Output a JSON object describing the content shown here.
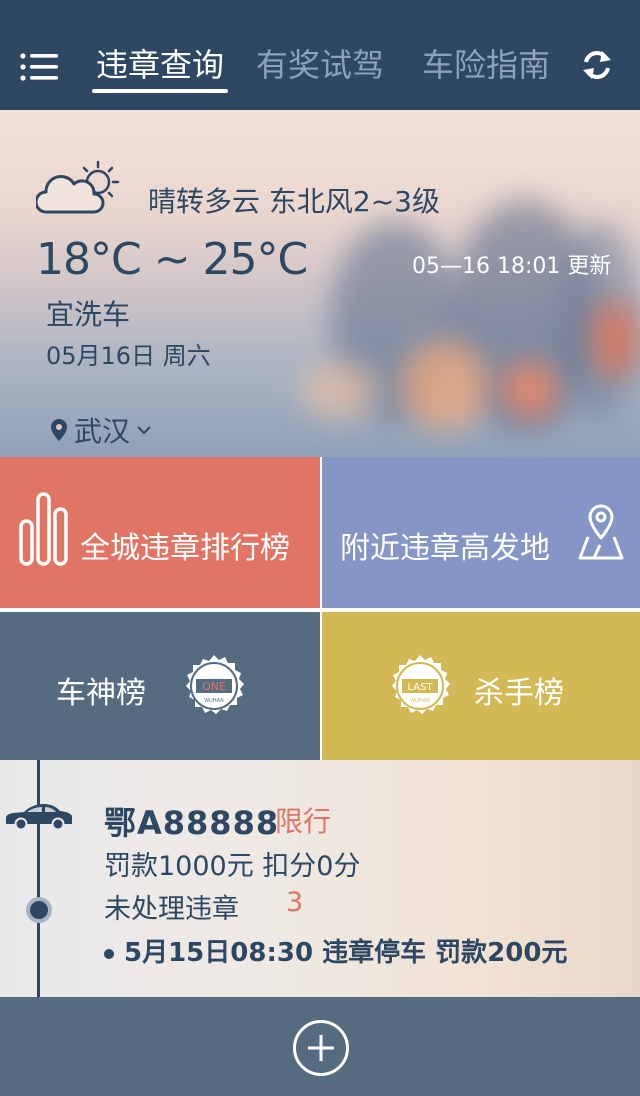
{
  "header": {
    "tabs": [
      {
        "label": "违章查询",
        "active": true
      },
      {
        "label": "有奖试驾",
        "active": false
      },
      {
        "label": "车险指南",
        "active": false
      }
    ],
    "menu_icon": "menu-icon",
    "sync_icon": "sync-icon"
  },
  "weather": {
    "condition": "晴转多云  东北风2~3级",
    "temperature": "18°C ~ 25°C",
    "update_time": "05—16  18:01  更新",
    "advice": "宜洗车",
    "date": "05月16日  周六",
    "city": "武汉",
    "icon": "partly-cloudy-icon"
  },
  "tiles": [
    {
      "label": "全城违章排行榜",
      "icon": "bar-chart-icon",
      "color": "#e07565"
    },
    {
      "label": "附近违章高发地",
      "icon": "map-pin-icon",
      "color": "#8495c6"
    },
    {
      "label": "车神榜",
      "icon": "one-wuhan-badge-icon",
      "badge_top": "ONE",
      "badge_bottom": "WUHAN",
      "color": "#546b80"
    },
    {
      "label": "杀手榜",
      "icon": "last-wuhan-badge-icon",
      "badge_top": "LAST",
      "badge_bottom": "WUHAN",
      "color": "#d2b956"
    }
  ],
  "car": {
    "plate": "鄂A88888",
    "restriction": "限行",
    "fine_summary": "罚款1000元  扣分0分",
    "pending_label": "未处理违章",
    "pending_count": "3",
    "violation": "5月15日08:30  违章停车  罚款200元"
  },
  "colors": {
    "primary": "#2e4763",
    "accent_red": "#e07565",
    "accent_blue": "#8495c6",
    "slate": "#546b80",
    "gold": "#d2b956"
  }
}
